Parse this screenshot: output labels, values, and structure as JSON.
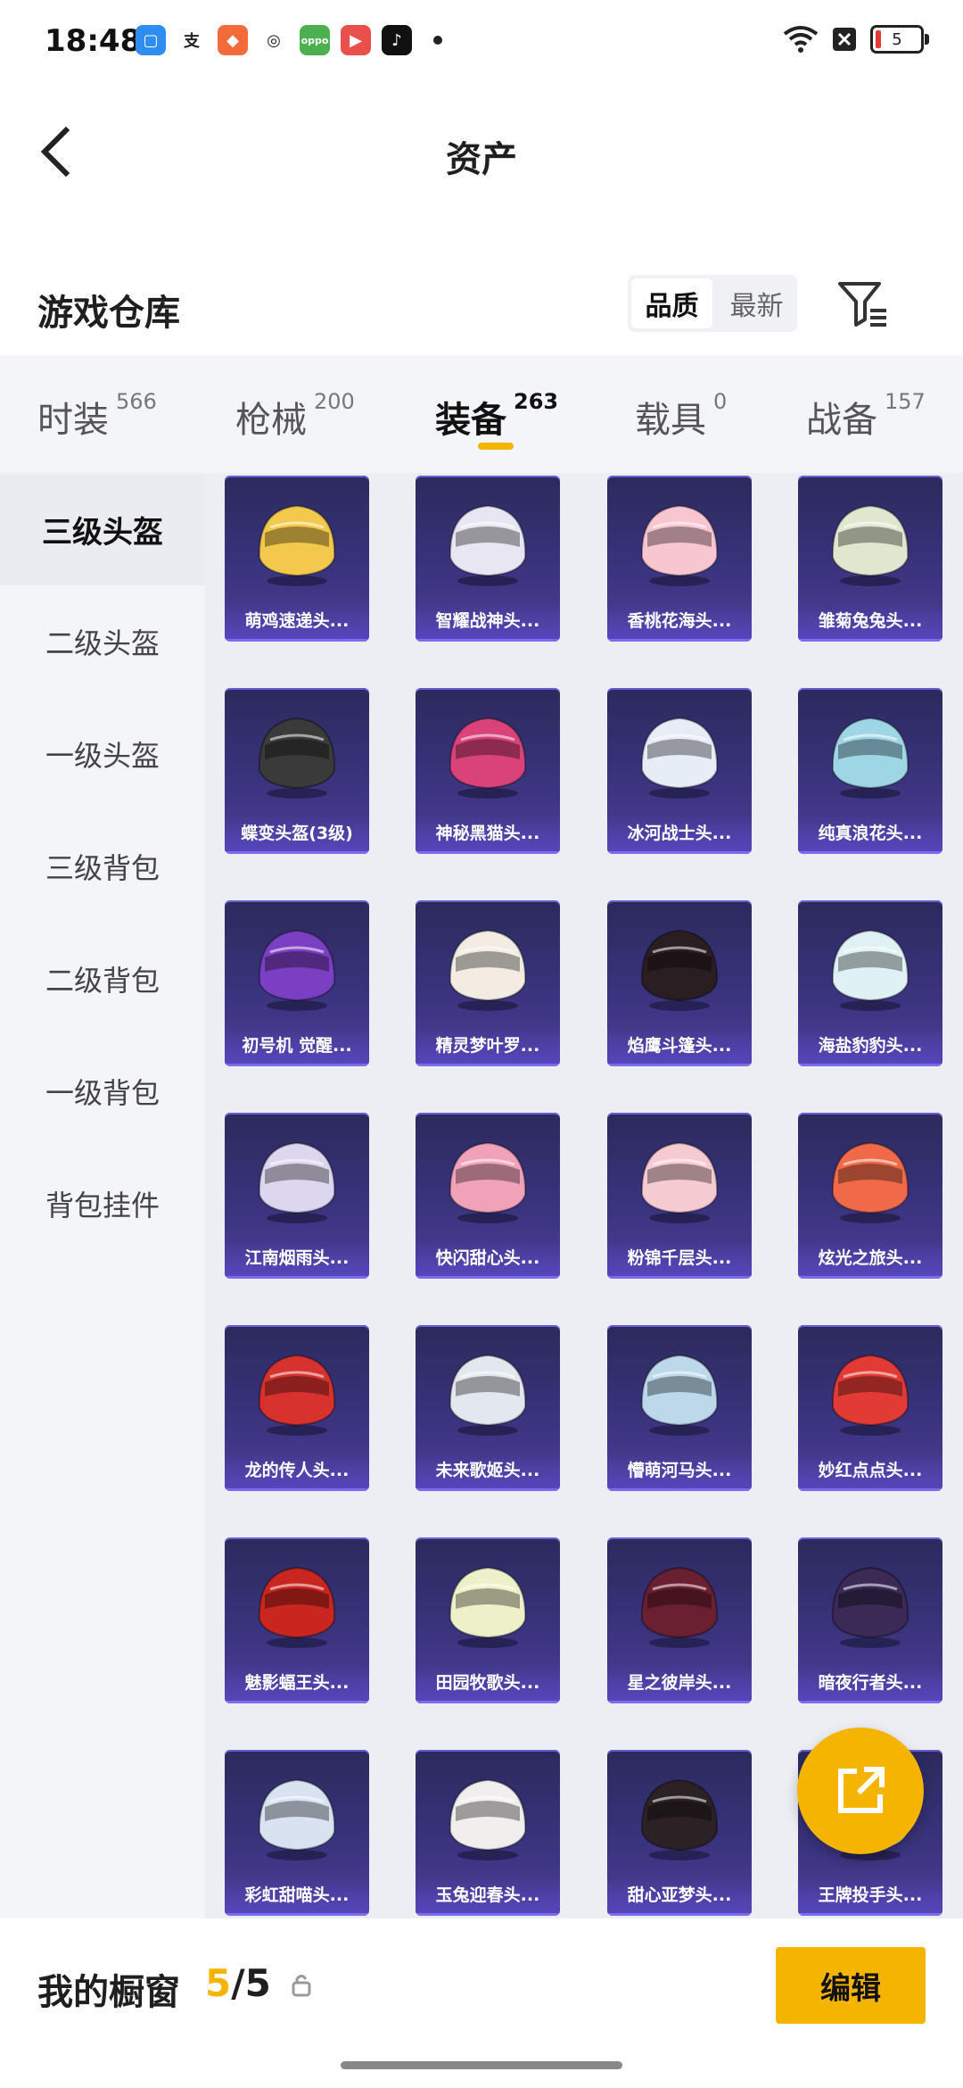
{
  "status": {
    "time": "18:48",
    "battery": "5"
  },
  "header": {
    "title": "资产"
  },
  "section": {
    "title": "游戏仓库",
    "sort_options": [
      "品质",
      "最新"
    ]
  },
  "tabs": [
    {
      "label": "时装",
      "count": "566"
    },
    {
      "label": "枪械",
      "count": "200"
    },
    {
      "label": "装备",
      "count": "263"
    },
    {
      "label": "载具",
      "count": "0"
    },
    {
      "label": "战备",
      "count": "157"
    }
  ],
  "sidebar": {
    "items": [
      "三级头盔",
      "二级头盔",
      "一级头盔",
      "三级背包",
      "二级背包",
      "一级背包",
      "背包挂件"
    ]
  },
  "items": [
    {
      "name": "萌鸡速递头...",
      "color": "#f2c94c"
    },
    {
      "name": "智耀战神头...",
      "color": "#e8e6f2"
    },
    {
      "name": "香桃花海头...",
      "color": "#f7c6d0"
    },
    {
      "name": "雏菊兔兔头...",
      "color": "#dfe8cf"
    },
    {
      "name": "蝶变头盔(3级)",
      "color": "#3a3a3a"
    },
    {
      "name": "神秘黑猫头...",
      "color": "#d9437a"
    },
    {
      "name": "冰河战士头...",
      "color": "#e6edf6"
    },
    {
      "name": "纯真浪花头...",
      "color": "#9fd6e6"
    },
    {
      "name": "初号机 觉醒...",
      "color": "#7b3fc4"
    },
    {
      "name": "精灵梦叶罗...",
      "color": "#f2ece2"
    },
    {
      "name": "焰鹰斗篷头...",
      "color": "#2a1e22"
    },
    {
      "name": "海盐豹豹头...",
      "color": "#dff1f5"
    },
    {
      "name": "江南烟雨头...",
      "color": "#dcd6ee"
    },
    {
      "name": "快闪甜心头...",
      "color": "#f0a3b8"
    },
    {
      "name": "粉锦千层头...",
      "color": "#f5cad1"
    },
    {
      "name": "炫光之旅头...",
      "color": "#f06a4a"
    },
    {
      "name": "龙的传人头...",
      "color": "#d8322e"
    },
    {
      "name": "未来歌姬头...",
      "color": "#e3e7ee"
    },
    {
      "name": "懵萌河马头...",
      "color": "#bcd8ea"
    },
    {
      "name": "妙红点点头...",
      "color": "#e23a35"
    },
    {
      "name": "魅影蝠王头...",
      "color": "#c8261f"
    },
    {
      "name": "田园牧歌头...",
      "color": "#eef0c9"
    },
    {
      "name": "星之彼岸头...",
      "color": "#6a2030"
    },
    {
      "name": "暗夜行者头...",
      "color": "#3a2a55"
    },
    {
      "name": "彩虹甜喵头...",
      "color": "#d8e2f0"
    },
    {
      "name": "玉兔迎春头...",
      "color": "#f2eeee"
    },
    {
      "name": "甜心亚梦头...",
      "color": "#2c2226"
    },
    {
      "name": "王牌投手头...",
      "color": "#d6d6d6"
    }
  ],
  "bottom": {
    "label": "我的橱窗",
    "current": "5",
    "total": "/5",
    "edit": "编辑"
  },
  "colors": {
    "accent": "#f5b400"
  }
}
